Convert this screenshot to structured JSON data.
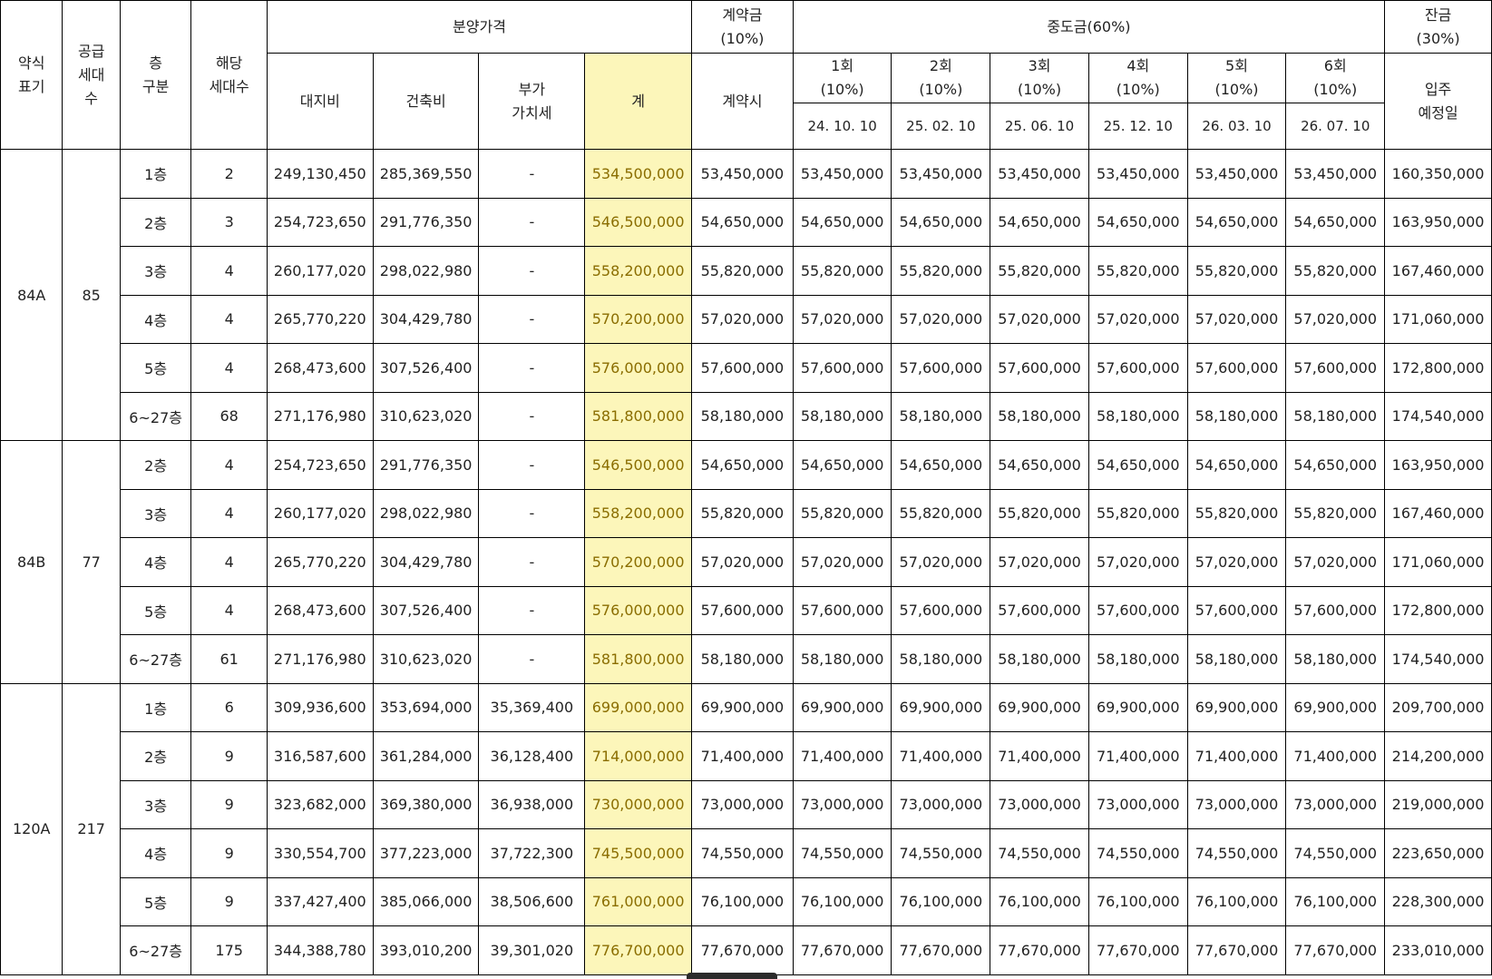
{
  "headers": {
    "type": "약식\n표기",
    "supply": "공급\n세대\n수",
    "floor": "층\n구분",
    "units": "해당\n세대수",
    "price_group": "분양가격",
    "land": "대지비",
    "building": "건축비",
    "vat": "부가\n가치세",
    "total": "계",
    "deposit_group": "계약금\n(10%)",
    "deposit_when": "계약시",
    "middle_group": "중도금(60%)",
    "middle": [
      {
        "label": "1회\n(10%)",
        "date": "24. 10. 10"
      },
      {
        "label": "2회\n(10%)",
        "date": "25. 02. 10"
      },
      {
        "label": "3회\n(10%)",
        "date": "25. 06. 10"
      },
      {
        "label": "4회\n(10%)",
        "date": "25. 12. 10"
      },
      {
        "label": "5회\n(10%)",
        "date": "26. 03. 10"
      },
      {
        "label": "6회\n(10%)",
        "date": "26. 07. 10"
      }
    ],
    "balance_group": "잔금\n(30%)",
    "balance_when": "입주\n예정일"
  },
  "groups": [
    {
      "type": "84A",
      "supply": "85",
      "rows": [
        {
          "floor": "1층",
          "units": "2",
          "land": "249,130,450",
          "building": "285,369,550",
          "vat": "-",
          "total": "534,500,000",
          "deposit": "53,450,000",
          "middle": "53,450,000",
          "balance": "160,350,000"
        },
        {
          "floor": "2층",
          "units": "3",
          "land": "254,723,650",
          "building": "291,776,350",
          "vat": "-",
          "total": "546,500,000",
          "deposit": "54,650,000",
          "middle": "54,650,000",
          "balance": "163,950,000"
        },
        {
          "floor": "3층",
          "units": "4",
          "land": "260,177,020",
          "building": "298,022,980",
          "vat": "-",
          "total": "558,200,000",
          "deposit": "55,820,000",
          "middle": "55,820,000",
          "balance": "167,460,000"
        },
        {
          "floor": "4층",
          "units": "4",
          "land": "265,770,220",
          "building": "304,429,780",
          "vat": "-",
          "total": "570,200,000",
          "deposit": "57,020,000",
          "middle": "57,020,000",
          "balance": "171,060,000"
        },
        {
          "floor": "5층",
          "units": "4",
          "land": "268,473,600",
          "building": "307,526,400",
          "vat": "-",
          "total": "576,000,000",
          "deposit": "57,600,000",
          "middle": "57,600,000",
          "balance": "172,800,000"
        },
        {
          "floor": "6~27층",
          "units": "68",
          "land": "271,176,980",
          "building": "310,623,020",
          "vat": "-",
          "total": "581,800,000",
          "deposit": "58,180,000",
          "middle": "58,180,000",
          "balance": "174,540,000"
        }
      ]
    },
    {
      "type": "84B",
      "supply": "77",
      "rows": [
        {
          "floor": "2층",
          "units": "4",
          "land": "254,723,650",
          "building": "291,776,350",
          "vat": "-",
          "total": "546,500,000",
          "deposit": "54,650,000",
          "middle": "54,650,000",
          "balance": "163,950,000"
        },
        {
          "floor": "3층",
          "units": "4",
          "land": "260,177,020",
          "building": "298,022,980",
          "vat": "-",
          "total": "558,200,000",
          "deposit": "55,820,000",
          "middle": "55,820,000",
          "balance": "167,460,000"
        },
        {
          "floor": "4층",
          "units": "4",
          "land": "265,770,220",
          "building": "304,429,780",
          "vat": "-",
          "total": "570,200,000",
          "deposit": "57,020,000",
          "middle": "57,020,000",
          "balance": "171,060,000"
        },
        {
          "floor": "5층",
          "units": "4",
          "land": "268,473,600",
          "building": "307,526,400",
          "vat": "-",
          "total": "576,000,000",
          "deposit": "57,600,000",
          "middle": "57,600,000",
          "balance": "172,800,000"
        },
        {
          "floor": "6~27층",
          "units": "61",
          "land": "271,176,980",
          "building": "310,623,020",
          "vat": "-",
          "total": "581,800,000",
          "deposit": "58,180,000",
          "middle": "58,180,000",
          "balance": "174,540,000"
        }
      ]
    },
    {
      "type": "120A",
      "supply": "217",
      "rows": [
        {
          "floor": "1층",
          "units": "6",
          "land": "309,936,600",
          "building": "353,694,000",
          "vat": "35,369,400",
          "total": "699,000,000",
          "deposit": "69,900,000",
          "middle": "69,900,000",
          "balance": "209,700,000"
        },
        {
          "floor": "2층",
          "units": "9",
          "land": "316,587,600",
          "building": "361,284,000",
          "vat": "36,128,400",
          "total": "714,000,000",
          "deposit": "71,400,000",
          "middle": "71,400,000",
          "balance": "214,200,000"
        },
        {
          "floor": "3층",
          "units": "9",
          "land": "323,682,000",
          "building": "369,380,000",
          "vat": "36,938,000",
          "total": "730,000,000",
          "deposit": "73,000,000",
          "middle": "73,000,000",
          "balance": "219,000,000"
        },
        {
          "floor": "4층",
          "units": "9",
          "land": "330,554,700",
          "building": "377,223,000",
          "vat": "37,722,300",
          "total": "745,500,000",
          "deposit": "74,550,000",
          "middle": "74,550,000",
          "balance": "223,650,000"
        },
        {
          "floor": "5층",
          "units": "9",
          "land": "337,427,400",
          "building": "385,066,000",
          "vat": "38,506,600",
          "total": "761,000,000",
          "deposit": "76,100,000",
          "middle": "76,100,000",
          "balance": "228,300,000"
        },
        {
          "floor": "6~27층",
          "units": "175",
          "land": "344,388,780",
          "building": "393,010,200",
          "vat": "39,301,020",
          "total": "776,700,000",
          "deposit": "77,670,000",
          "middle": "77,670,000",
          "balance": "233,010,000"
        }
      ]
    }
  ],
  "colors": {
    "highlight_bg": "#fcf6ba",
    "highlight_text": "#8a6d00"
  }
}
